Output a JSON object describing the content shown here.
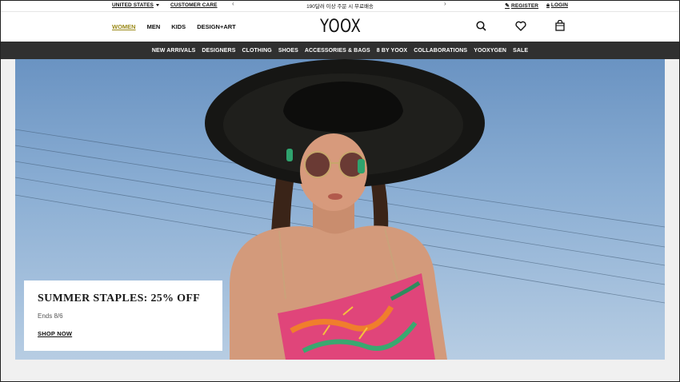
{
  "topbar": {
    "country": "UNITED STATES",
    "customer_care": "CUSTOMER CARE",
    "promo_text": "190달러 이상 주문 시 무료배송",
    "register": "REGISTER",
    "login": "LOGIN"
  },
  "header": {
    "logo": "YOOX",
    "gender_tabs": [
      "WOMEN",
      "MEN",
      "KIDS",
      "DESIGN+ART"
    ],
    "active_tab": "WOMEN",
    "icons": [
      "search-icon",
      "heart-icon",
      "shopping-bag-icon"
    ]
  },
  "nav": {
    "items": [
      "NEW ARRIVALS",
      "DESIGNERS",
      "CLOTHING",
      "SHOES",
      "ACCESSORIES & BAGS",
      "8 BY YOOX",
      "COLLABORATIONS",
      "YOOXYGEN",
      "SALE"
    ]
  },
  "hero": {
    "title": "SUMMER STAPLES: 25% OFF",
    "subtitle": "Ends 8/6",
    "cta": "SHOP NOW"
  },
  "colors": {
    "accent_active": "#9b8a1a",
    "nav_bg": "#303030",
    "sky": "#8cafd4",
    "dress_pink": "#e0457a"
  }
}
